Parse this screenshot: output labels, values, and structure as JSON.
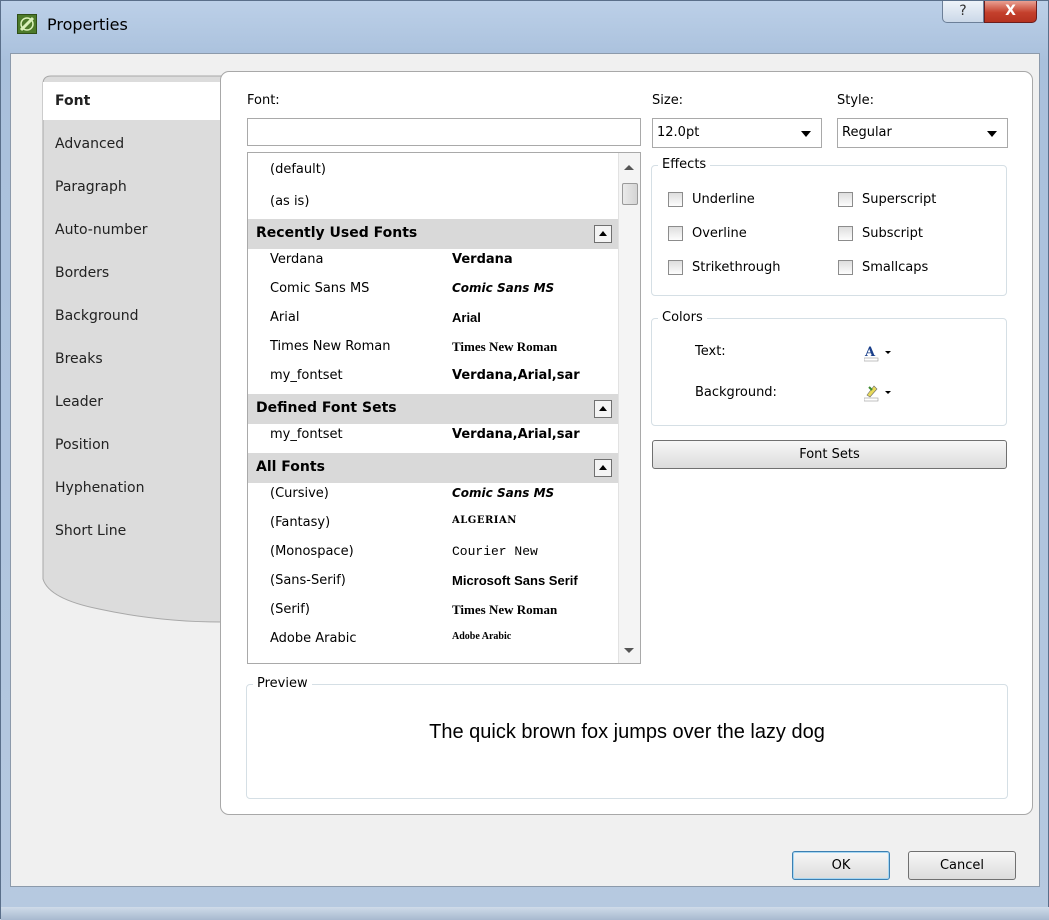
{
  "window": {
    "title": "Properties",
    "help_glyph": "?",
    "close_glyph": "X"
  },
  "tabs": [
    {
      "label": "Font",
      "active": true
    },
    {
      "label": "Advanced",
      "active": false
    },
    {
      "label": "Paragraph",
      "active": false
    },
    {
      "label": "Auto-number",
      "active": false
    },
    {
      "label": "Borders",
      "active": false
    },
    {
      "label": "Background",
      "active": false
    },
    {
      "label": "Breaks",
      "active": false
    },
    {
      "label": "Leader",
      "active": false
    },
    {
      "label": "Position",
      "active": false
    },
    {
      "label": "Hyphenation",
      "active": false
    },
    {
      "label": "Short Line",
      "active": false
    }
  ],
  "font": {
    "label": "Font:",
    "value": "",
    "plain_items": [
      "(default)",
      "(as is)"
    ],
    "groups": [
      {
        "title": "Recently Used Fonts",
        "items": [
          {
            "name": "Verdana",
            "sample": "Verdana"
          },
          {
            "name": "Comic Sans MS",
            "sample": "Comic Sans MS"
          },
          {
            "name": "Arial",
            "sample": "Arial"
          },
          {
            "name": "Times New Roman",
            "sample": "Times New Roman"
          },
          {
            "name": "my_fontset",
            "sample": "Verdana,Arial,sar"
          }
        ]
      },
      {
        "title": "Defined Font Sets",
        "items": [
          {
            "name": "my_fontset",
            "sample": "Verdana,Arial,sar"
          }
        ]
      },
      {
        "title": "All Fonts",
        "items": [
          {
            "name": "(Cursive)",
            "sample": "Comic Sans MS"
          },
          {
            "name": "(Fantasy)",
            "sample": "ALGERIAN"
          },
          {
            "name": "(Monospace)",
            "sample": "Courier New"
          },
          {
            "name": "(Sans-Serif)",
            "sample": "Microsoft Sans Serif"
          },
          {
            "name": "(Serif)",
            "sample": "Times New Roman"
          },
          {
            "name": "Adobe Arabic",
            "sample": "Adobe Arabic"
          }
        ]
      }
    ]
  },
  "size": {
    "label": "Size:",
    "value": "12.0pt"
  },
  "style": {
    "label": "Style:",
    "value": "Regular"
  },
  "effects": {
    "title": "Effects",
    "items": [
      {
        "label": "Underline",
        "checked": false
      },
      {
        "label": "Superscript",
        "checked": false
      },
      {
        "label": "Overline",
        "checked": false
      },
      {
        "label": "Subscript",
        "checked": false
      },
      {
        "label": "Strikethrough",
        "checked": false
      },
      {
        "label": "Smallcaps",
        "checked": false
      }
    ]
  },
  "colors": {
    "title": "Colors",
    "text_label": "Text:",
    "background_label": "Background:",
    "text_icon": "font-color-icon",
    "background_icon": "highlight-color-icon"
  },
  "font_sets_button": "Font Sets",
  "preview": {
    "title": "Preview",
    "text": "The quick brown fox jumps over the lazy dog"
  },
  "buttons": {
    "ok": "OK",
    "cancel": "Cancel"
  }
}
